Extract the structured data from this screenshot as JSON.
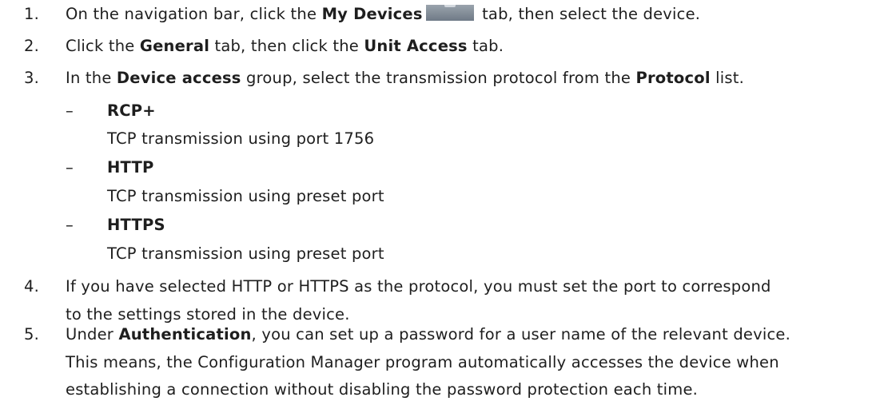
{
  "steps": [
    {
      "number": "1.",
      "parts": [
        "On the navigation bar, click the ",
        "My Devices",
        " tab, then select the device."
      ],
      "button_icon": "my-devices-icon"
    },
    {
      "number": "2.",
      "parts": [
        "Click the ",
        "General",
        " tab, then click the ",
        "Unit Access",
        " tab."
      ]
    },
    {
      "number": "3.",
      "parts": [
        "In the ",
        "Device access",
        " group, select the transmission protocol from the ",
        "Protocol",
        " list."
      ],
      "options": [
        {
          "dash": "–",
          "name": "RCP+",
          "desc": "TCP transmission using port 1756"
        },
        {
          "dash": "–",
          "name": "HTTP",
          "desc": "TCP transmission using preset port"
        },
        {
          "dash": "–",
          "name": "HTTPS",
          "desc": "TCP transmission using preset port"
        }
      ]
    },
    {
      "number": "4.",
      "lines": [
        "If you have selected HTTP or HTTPS as the protocol, you must set the port to correspond",
        "to the settings stored in the device."
      ]
    },
    {
      "number": "5.",
      "parts": [
        "Under ",
        "Authentication",
        ", you can set up a password for a user name of the relevant device."
      ],
      "lines": [
        "This means, the Configuration Manager program automatically accesses the device when",
        "establishing a connection without disabling the password protection each time."
      ]
    }
  ]
}
